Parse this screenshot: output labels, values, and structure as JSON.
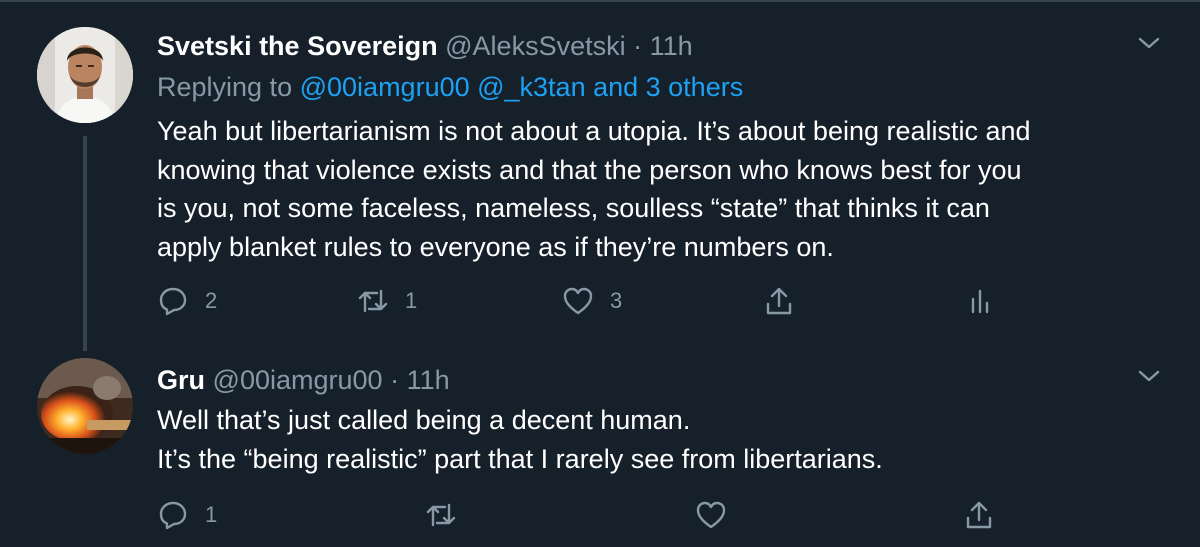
{
  "tweets": [
    {
      "name": "Svetski the Sovereign",
      "handle": "@AleksSvetski",
      "separator": "·",
      "time": "11h",
      "replying_prefix": "Replying to",
      "replying_mentions": "@00iamgru00 @_k3tan and 3 others",
      "text_lines": [
        "Yeah but libertarianism is not about a utopia. It’s about being realistic and",
        "knowing that violence exists and that the person who knows best for you",
        "is you, not some faceless, nameless, soulless “state” that thinks it can",
        "apply blanket rules to everyone as if they’re numbers on."
      ],
      "reply_count": "2",
      "retweet_count": "1",
      "like_count": "3"
    },
    {
      "name": "Gru",
      "handle": "@00iamgru00",
      "separator": "·",
      "time": "11h",
      "text_lines": [
        "Well that’s just called being a decent human.",
        "It’s the “being realistic” part that I rarely see from libertarians."
      ],
      "reply_count": "1"
    }
  ],
  "icons": {
    "reply": "reply-icon",
    "retweet": "retweet-icon",
    "like": "heart-icon",
    "share": "share-icon",
    "analytics": "analytics-icon",
    "more": "chevron-down-icon"
  },
  "colors": {
    "background": "#15202b",
    "text": "#ffffff",
    "secondary_text": "#8899a6",
    "link": "#1da1f2",
    "divider": "#38444d"
  }
}
